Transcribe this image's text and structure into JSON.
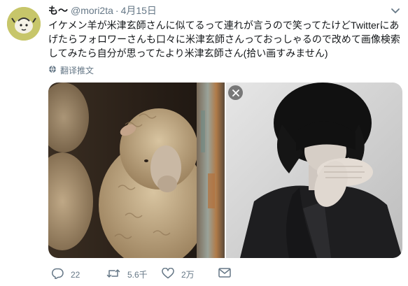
{
  "tweet": {
    "display_name": "も〜",
    "handle": "@mori2ta",
    "separator": "·",
    "timestamp": "4月15日",
    "text_lines": [
      "イケメン羊が米津玄師さんに似てるって連れが言うので笑ってたけどTwitterにあ",
      "げたらフォロワーさんも口々に米津玄師さんっておっしゃるので改めて画像検索",
      "してみたら自分が思ってたより米津玄師さん(拾い画すみません)"
    ],
    "translate_label": "翻译推文"
  },
  "actions": {
    "reply_count": "22",
    "retweet_count": "5.6千",
    "like_count": "2万"
  },
  "icons": {
    "caret": "chevron-down-icon",
    "translate": "globe-icon",
    "close": "close-icon",
    "reply": "reply-icon",
    "retweet": "retweet-icon",
    "like": "heart-icon",
    "dm": "envelope-icon"
  },
  "colors": {
    "secondary_text": "#657786",
    "primary_text": "#14171a"
  }
}
